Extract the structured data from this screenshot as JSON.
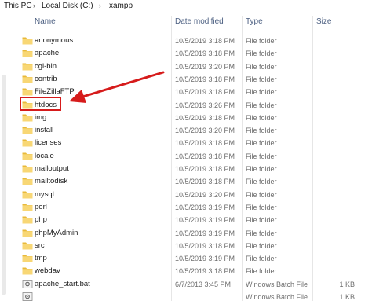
{
  "breadcrumb": {
    "items": [
      "This PC",
      "Local Disk (C:)",
      "xampp"
    ],
    "separator": "›"
  },
  "columns": {
    "name": "Name",
    "date_modified": "Date modified",
    "type": "Type",
    "size": "Size"
  },
  "files": [
    {
      "name": "anonymous",
      "date": "10/5/2019 3:18 PM",
      "type": "File folder",
      "size": "",
      "icon": "folder-icon"
    },
    {
      "name": "apache",
      "date": "10/5/2019 3:18 PM",
      "type": "File folder",
      "size": "",
      "icon": "folder-icon"
    },
    {
      "name": "cgi-bin",
      "date": "10/5/2019 3:20 PM",
      "type": "File folder",
      "size": "",
      "icon": "folder-icon"
    },
    {
      "name": "contrib",
      "date": "10/5/2019 3:18 PM",
      "type": "File folder",
      "size": "",
      "icon": "folder-icon"
    },
    {
      "name": "FileZillaFTP",
      "date": "10/5/2019 3:18 PM",
      "type": "File folder",
      "size": "",
      "icon": "folder-icon"
    },
    {
      "name": "htdocs",
      "date": "10/5/2019 3:26 PM",
      "type": "File folder",
      "size": "",
      "icon": "folder-icon"
    },
    {
      "name": "img",
      "date": "10/5/2019 3:18 PM",
      "type": "File folder",
      "size": "",
      "icon": "folder-icon"
    },
    {
      "name": "install",
      "date": "10/5/2019 3:20 PM",
      "type": "File folder",
      "size": "",
      "icon": "folder-icon"
    },
    {
      "name": "licenses",
      "date": "10/5/2019 3:18 PM",
      "type": "File folder",
      "size": "",
      "icon": "folder-icon"
    },
    {
      "name": "locale",
      "date": "10/5/2019 3:18 PM",
      "type": "File folder",
      "size": "",
      "icon": "folder-icon"
    },
    {
      "name": "mailoutput",
      "date": "10/5/2019 3:18 PM",
      "type": "File folder",
      "size": "",
      "icon": "folder-icon"
    },
    {
      "name": "mailtodisk",
      "date": "10/5/2019 3:18 PM",
      "type": "File folder",
      "size": "",
      "icon": "folder-icon"
    },
    {
      "name": "mysql",
      "date": "10/5/2019 3:20 PM",
      "type": "File folder",
      "size": "",
      "icon": "folder-icon"
    },
    {
      "name": "perl",
      "date": "10/5/2019 3:19 PM",
      "type": "File folder",
      "size": "",
      "icon": "folder-icon"
    },
    {
      "name": "php",
      "date": "10/5/2019 3:19 PM",
      "type": "File folder",
      "size": "",
      "icon": "folder-icon"
    },
    {
      "name": "phpMyAdmin",
      "date": "10/5/2019 3:19 PM",
      "type": "File folder",
      "size": "",
      "icon": "folder-icon"
    },
    {
      "name": "src",
      "date": "10/5/2019 3:18 PM",
      "type": "File folder",
      "size": "",
      "icon": "folder-icon"
    },
    {
      "name": "tmp",
      "date": "10/5/2019 3:19 PM",
      "type": "File folder",
      "size": "",
      "icon": "folder-icon"
    },
    {
      "name": "webdav",
      "date": "10/5/2019 3:18 PM",
      "type": "File folder",
      "size": "",
      "icon": "folder-icon"
    },
    {
      "name": "apache_start.bat",
      "date": "6/7/2013 3:45 PM",
      "type": "Windows Batch File",
      "size": "1 KB",
      "icon": "batch-file-icon"
    },
    {
      "name": "",
      "date": "",
      "type": "Windows Batch File",
      "size": "1 KB",
      "icon": "batch-file-icon"
    }
  ],
  "annotation": {
    "highlighted_item": "htdocs",
    "color": "#d61b1b"
  },
  "colors": {
    "folder_body": "#f8d775",
    "folder_tab": "#e8b93a",
    "header_text": "#4d6082",
    "meta_text": "#6d6d6d"
  }
}
